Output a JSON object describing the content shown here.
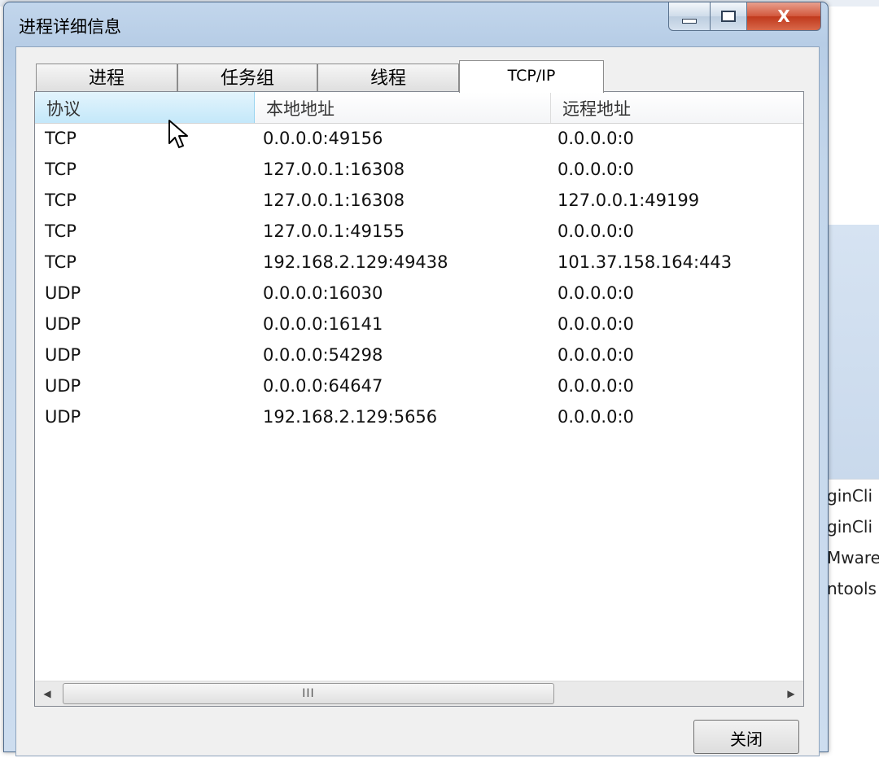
{
  "window": {
    "title": "进程详细信息",
    "close_glyph": "X"
  },
  "tabs": [
    {
      "label": "进程",
      "active": false
    },
    {
      "label": "任务组",
      "active": false
    },
    {
      "label": "线程",
      "active": false
    },
    {
      "label": "TCP/IP",
      "active": true
    }
  ],
  "table": {
    "columns": [
      "协议",
      "本地地址",
      "远程地址"
    ],
    "rows": [
      [
        "TCP",
        "0.0.0.0:49156",
        "0.0.0.0:0"
      ],
      [
        "TCP",
        "127.0.0.1:16308",
        "0.0.0.0:0"
      ],
      [
        "TCP",
        "127.0.0.1:16308",
        "127.0.0.1:49199"
      ],
      [
        "TCP",
        "127.0.0.1:49155",
        "0.0.0.0:0"
      ],
      [
        "TCP",
        "192.168.2.129:49438",
        "101.37.158.164:443"
      ],
      [
        "UDP",
        "0.0.0.0:16030",
        "0.0.0.0:0"
      ],
      [
        "UDP",
        "0.0.0.0:16141",
        "0.0.0.0:0"
      ],
      [
        "UDP",
        "0.0.0.0:54298",
        "0.0.0.0:0"
      ],
      [
        "UDP",
        "0.0.0.0:64647",
        "0.0.0.0:0"
      ],
      [
        "UDP",
        "192.168.2.129:5656",
        "0.0.0.0:0"
      ]
    ]
  },
  "scrollbar": {
    "grip": "III",
    "left_arrow": "◀",
    "right_arrow": "▶"
  },
  "buttons": {
    "close_label": "关闭"
  },
  "background": {
    "right_items": [
      "ginCli",
      "ginCli",
      "Mware",
      "ntools"
    ]
  },
  "colors": {
    "header_hot": "#c4e8fa",
    "close_red": "#c0391c",
    "window_frame": "#b7cde6"
  }
}
